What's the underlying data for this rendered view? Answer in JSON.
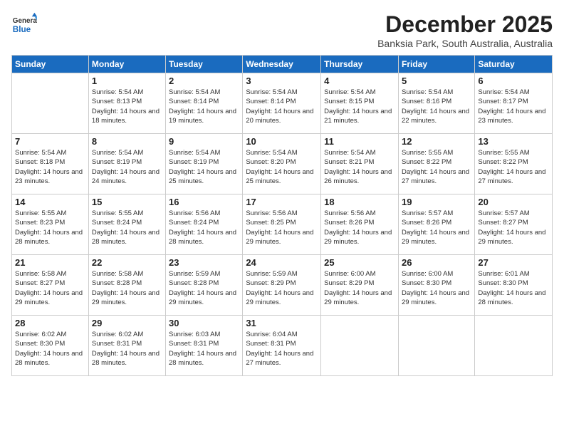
{
  "logo": {
    "text_general": "General",
    "text_blue": "Blue"
  },
  "header": {
    "month": "December 2025",
    "location": "Banksia Park, South Australia, Australia"
  },
  "weekdays": [
    "Sunday",
    "Monday",
    "Tuesday",
    "Wednesday",
    "Thursday",
    "Friday",
    "Saturday"
  ],
  "weeks": [
    [
      {
        "day": "",
        "sunrise": "",
        "sunset": "",
        "daylight": ""
      },
      {
        "day": "1",
        "sunrise": "Sunrise: 5:54 AM",
        "sunset": "Sunset: 8:13 PM",
        "daylight": "Daylight: 14 hours and 18 minutes."
      },
      {
        "day": "2",
        "sunrise": "Sunrise: 5:54 AM",
        "sunset": "Sunset: 8:14 PM",
        "daylight": "Daylight: 14 hours and 19 minutes."
      },
      {
        "day": "3",
        "sunrise": "Sunrise: 5:54 AM",
        "sunset": "Sunset: 8:14 PM",
        "daylight": "Daylight: 14 hours and 20 minutes."
      },
      {
        "day": "4",
        "sunrise": "Sunrise: 5:54 AM",
        "sunset": "Sunset: 8:15 PM",
        "daylight": "Daylight: 14 hours and 21 minutes."
      },
      {
        "day": "5",
        "sunrise": "Sunrise: 5:54 AM",
        "sunset": "Sunset: 8:16 PM",
        "daylight": "Daylight: 14 hours and 22 minutes."
      },
      {
        "day": "6",
        "sunrise": "Sunrise: 5:54 AM",
        "sunset": "Sunset: 8:17 PM",
        "daylight": "Daylight: 14 hours and 23 minutes."
      }
    ],
    [
      {
        "day": "7",
        "sunrise": "Sunrise: 5:54 AM",
        "sunset": "Sunset: 8:18 PM",
        "daylight": "Daylight: 14 hours and 23 minutes."
      },
      {
        "day": "8",
        "sunrise": "Sunrise: 5:54 AM",
        "sunset": "Sunset: 8:19 PM",
        "daylight": "Daylight: 14 hours and 24 minutes."
      },
      {
        "day": "9",
        "sunrise": "Sunrise: 5:54 AM",
        "sunset": "Sunset: 8:19 PM",
        "daylight": "Daylight: 14 hours and 25 minutes."
      },
      {
        "day": "10",
        "sunrise": "Sunrise: 5:54 AM",
        "sunset": "Sunset: 8:20 PM",
        "daylight": "Daylight: 14 hours and 25 minutes."
      },
      {
        "day": "11",
        "sunrise": "Sunrise: 5:54 AM",
        "sunset": "Sunset: 8:21 PM",
        "daylight": "Daylight: 14 hours and 26 minutes."
      },
      {
        "day": "12",
        "sunrise": "Sunrise: 5:55 AM",
        "sunset": "Sunset: 8:22 PM",
        "daylight": "Daylight: 14 hours and 27 minutes."
      },
      {
        "day": "13",
        "sunrise": "Sunrise: 5:55 AM",
        "sunset": "Sunset: 8:22 PM",
        "daylight": "Daylight: 14 hours and 27 minutes."
      }
    ],
    [
      {
        "day": "14",
        "sunrise": "Sunrise: 5:55 AM",
        "sunset": "Sunset: 8:23 PM",
        "daylight": "Daylight: 14 hours and 28 minutes."
      },
      {
        "day": "15",
        "sunrise": "Sunrise: 5:55 AM",
        "sunset": "Sunset: 8:24 PM",
        "daylight": "Daylight: 14 hours and 28 minutes."
      },
      {
        "day": "16",
        "sunrise": "Sunrise: 5:56 AM",
        "sunset": "Sunset: 8:24 PM",
        "daylight": "Daylight: 14 hours and 28 minutes."
      },
      {
        "day": "17",
        "sunrise": "Sunrise: 5:56 AM",
        "sunset": "Sunset: 8:25 PM",
        "daylight": "Daylight: 14 hours and 29 minutes."
      },
      {
        "day": "18",
        "sunrise": "Sunrise: 5:56 AM",
        "sunset": "Sunset: 8:26 PM",
        "daylight": "Daylight: 14 hours and 29 minutes."
      },
      {
        "day": "19",
        "sunrise": "Sunrise: 5:57 AM",
        "sunset": "Sunset: 8:26 PM",
        "daylight": "Daylight: 14 hours and 29 minutes."
      },
      {
        "day": "20",
        "sunrise": "Sunrise: 5:57 AM",
        "sunset": "Sunset: 8:27 PM",
        "daylight": "Daylight: 14 hours and 29 minutes."
      }
    ],
    [
      {
        "day": "21",
        "sunrise": "Sunrise: 5:58 AM",
        "sunset": "Sunset: 8:27 PM",
        "daylight": "Daylight: 14 hours and 29 minutes."
      },
      {
        "day": "22",
        "sunrise": "Sunrise: 5:58 AM",
        "sunset": "Sunset: 8:28 PM",
        "daylight": "Daylight: 14 hours and 29 minutes."
      },
      {
        "day": "23",
        "sunrise": "Sunrise: 5:59 AM",
        "sunset": "Sunset: 8:28 PM",
        "daylight": "Daylight: 14 hours and 29 minutes."
      },
      {
        "day": "24",
        "sunrise": "Sunrise: 5:59 AM",
        "sunset": "Sunset: 8:29 PM",
        "daylight": "Daylight: 14 hours and 29 minutes."
      },
      {
        "day": "25",
        "sunrise": "Sunrise: 6:00 AM",
        "sunset": "Sunset: 8:29 PM",
        "daylight": "Daylight: 14 hours and 29 minutes."
      },
      {
        "day": "26",
        "sunrise": "Sunrise: 6:00 AM",
        "sunset": "Sunset: 8:30 PM",
        "daylight": "Daylight: 14 hours and 29 minutes."
      },
      {
        "day": "27",
        "sunrise": "Sunrise: 6:01 AM",
        "sunset": "Sunset: 8:30 PM",
        "daylight": "Daylight: 14 hours and 28 minutes."
      }
    ],
    [
      {
        "day": "28",
        "sunrise": "Sunrise: 6:02 AM",
        "sunset": "Sunset: 8:30 PM",
        "daylight": "Daylight: 14 hours and 28 minutes."
      },
      {
        "day": "29",
        "sunrise": "Sunrise: 6:02 AM",
        "sunset": "Sunset: 8:31 PM",
        "daylight": "Daylight: 14 hours and 28 minutes."
      },
      {
        "day": "30",
        "sunrise": "Sunrise: 6:03 AM",
        "sunset": "Sunset: 8:31 PM",
        "daylight": "Daylight: 14 hours and 28 minutes."
      },
      {
        "day": "31",
        "sunrise": "Sunrise: 6:04 AM",
        "sunset": "Sunset: 8:31 PM",
        "daylight": "Daylight: 14 hours and 27 minutes."
      },
      {
        "day": "",
        "sunrise": "",
        "sunset": "",
        "daylight": ""
      },
      {
        "day": "",
        "sunrise": "",
        "sunset": "",
        "daylight": ""
      },
      {
        "day": "",
        "sunrise": "",
        "sunset": "",
        "daylight": ""
      }
    ]
  ]
}
